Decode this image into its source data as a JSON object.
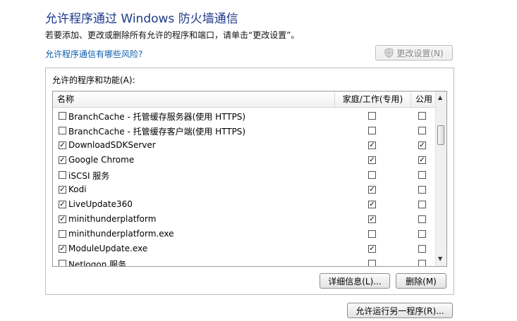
{
  "header": {
    "title": "允许程序通过 Windows 防火墙通信",
    "description": "若要添加、更改或删除所有允许的程序和端口，请单击“更改设置”。",
    "risk_link": "允许程序通信有哪些风险?",
    "change_settings": "更改设置(N)"
  },
  "group": {
    "label": "允许的程序和功能(A):",
    "columns": {
      "name": "名称",
      "home": "家庭/工作(专用)",
      "public": "公用"
    },
    "rows": [
      {
        "label": "BranchCache - 托管缓存服务器(使用 HTTPS)",
        "enabled": false,
        "home": false,
        "public": false
      },
      {
        "label": "BranchCache - 托管缓存客户端(使用 HTTPS)",
        "enabled": false,
        "home": false,
        "public": false
      },
      {
        "label": "DownloadSDKServer",
        "enabled": true,
        "home": true,
        "public": true
      },
      {
        "label": "Google Chrome",
        "enabled": true,
        "home": true,
        "public": true
      },
      {
        "label": "iSCSI 服务",
        "enabled": false,
        "home": false,
        "public": false
      },
      {
        "label": "Kodi",
        "enabled": true,
        "home": true,
        "public": false
      },
      {
        "label": "LiveUpdate360",
        "enabled": true,
        "home": true,
        "public": false
      },
      {
        "label": "minithunderplatform",
        "enabled": true,
        "home": true,
        "public": false
      },
      {
        "label": "minithunderplatform.exe",
        "enabled": false,
        "home": false,
        "public": false
      },
      {
        "label": "ModuleUpdate.exe",
        "enabled": true,
        "home": true,
        "public": false
      },
      {
        "label": "Netlogon 服务",
        "enabled": false,
        "home": false,
        "public": false
      }
    ],
    "details_button": "详细信息(L)...",
    "remove_button": "删除(M)"
  },
  "footer": {
    "allow_another": "允许运行另一程序(R)..."
  },
  "icons": {
    "shield": "shield-icon",
    "scroll_up": "scroll-up-arrow-icon",
    "scroll_down": "scroll-down-arrow-icon",
    "check": "checkmark-icon"
  }
}
